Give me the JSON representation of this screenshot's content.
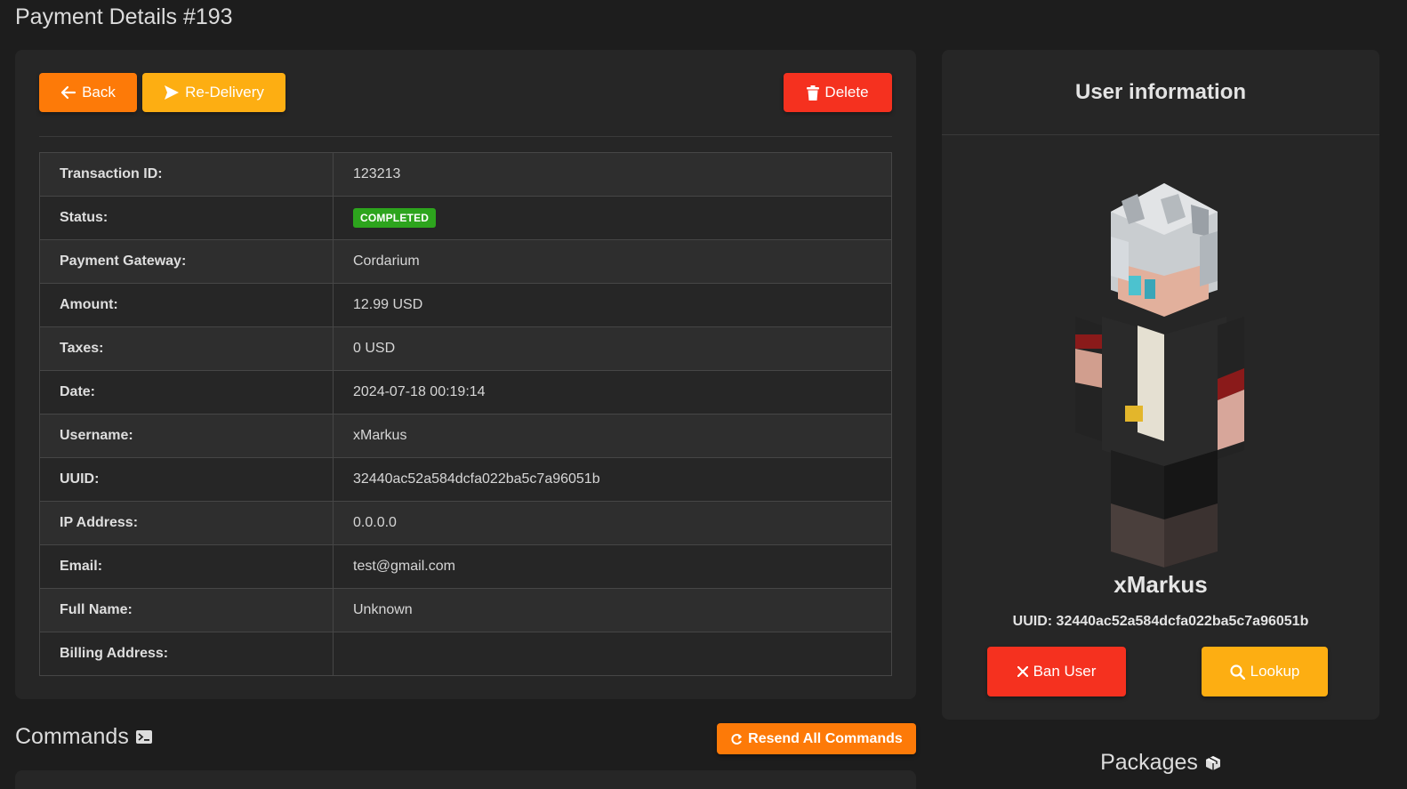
{
  "page": {
    "title": "Payment Details #193"
  },
  "toolbar": {
    "back_label": "Back",
    "redelivery_label": "Re-Delivery",
    "delete_label": "Delete"
  },
  "details": {
    "rows": [
      {
        "label": "Transaction ID:",
        "value": "123213"
      },
      {
        "label": "Status:",
        "value": "COMPLETED"
      },
      {
        "label": "Payment Gateway:",
        "value": "Cordarium"
      },
      {
        "label": "Amount:",
        "value": "12.99 USD"
      },
      {
        "label": "Taxes:",
        "value": "0 USD"
      },
      {
        "label": "Date:",
        "value": "2024-07-18 00:19:14"
      },
      {
        "label": "Username:",
        "value": "xMarkus"
      },
      {
        "label": "UUID:",
        "value": "32440ac52a584dcfa022ba5c7a96051b"
      },
      {
        "label": "IP Address:",
        "value": "0.0.0.0"
      },
      {
        "label": "Email:",
        "value": "test@gmail.com"
      },
      {
        "label": "Full Name:",
        "value": "Unknown"
      },
      {
        "label": "Billing Address:",
        "value": ""
      }
    ]
  },
  "user": {
    "header": "User information",
    "username": "xMarkus",
    "uuid_line": "UUID: 32440ac52a584dcfa022ba5c7a96051b",
    "ban_label": "Ban User",
    "lookup_label": "Lookup"
  },
  "commands": {
    "title": "Commands",
    "resend_label": "Resend All Commands"
  },
  "packages": {
    "title": "Packages"
  },
  "colors": {
    "orange": "#fd7a08",
    "yellow": "#fdae12",
    "red": "#f5311f",
    "status_green": "#2da41d",
    "background": "#1d1d1d",
    "card": "#262626"
  },
  "icons": [
    "arrow-left-icon",
    "send-icon",
    "trash-icon",
    "close-icon",
    "search-icon",
    "refresh-icon",
    "terminal-icon",
    "box-icon"
  ]
}
